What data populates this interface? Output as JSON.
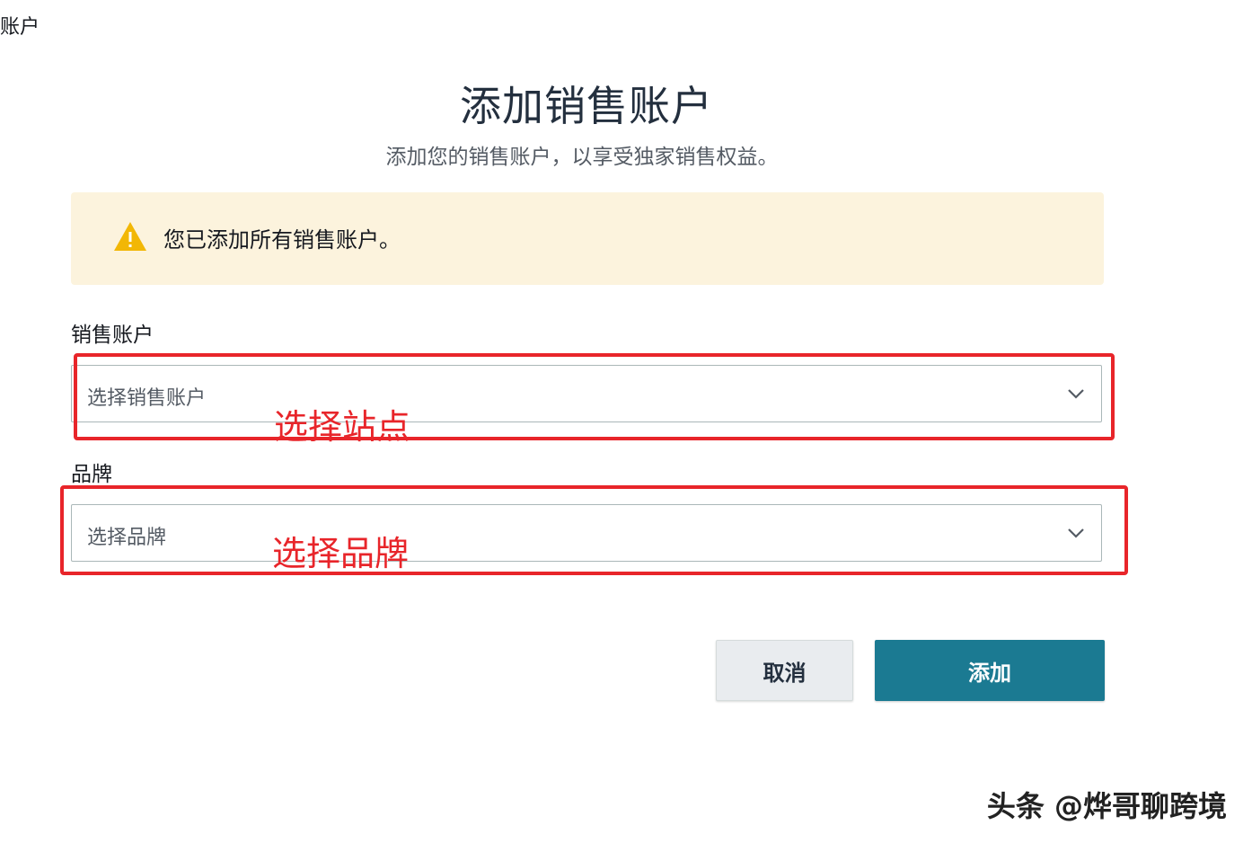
{
  "corner_label": "账户",
  "header": {
    "title": "添加销售账户",
    "subtitle": "添加您的销售账户，以享受独家销售权益。"
  },
  "alert": {
    "icon": "warning-icon",
    "text": "您已添加所有销售账户。",
    "background_color": "#fcf3dd",
    "icon_color": "#f2b705"
  },
  "form": {
    "sales_account": {
      "label": "销售账户",
      "placeholder": "选择销售账户"
    },
    "brand": {
      "label": "品牌",
      "placeholder": "选择品牌"
    }
  },
  "annotations": {
    "sales_account_note": "选择站点",
    "brand_note": "选择品牌",
    "color": "#e8252a"
  },
  "buttons": {
    "cancel": "取消",
    "add": "添加",
    "primary_color": "#1b7a92"
  },
  "watermark": "头条 @烨哥聊跨境"
}
